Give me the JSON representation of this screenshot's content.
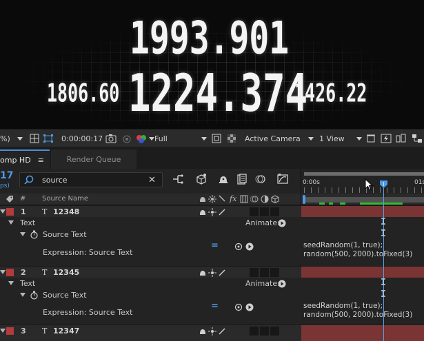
{
  "viewer": {
    "numbers": {
      "top": "1993.901",
      "middle": "1224.374",
      "left": "1806.60",
      "right": "1426.22"
    }
  },
  "viewer_toolbar": {
    "zoom_fragment": "%)",
    "timecode": "0:00:00:17",
    "resolution": "Full",
    "camera": "Active Camera",
    "views": "1 View"
  },
  "tabs": {
    "comp": "omp HD",
    "comp_menu": "≡",
    "render_queue": "Render Queue"
  },
  "timeline": {
    "current_frame": "17",
    "current_frame_sub": "ps)",
    "search_value": "source",
    "ruler_start": "0:00s",
    "ruler_end": "01s"
  },
  "columns": {
    "number": "#",
    "source_name": "Source Name"
  },
  "layers": [
    {
      "number": "1",
      "name": "12348",
      "group": "Text",
      "animate_label": "Animate:",
      "property": "Source Text",
      "expression_label": "Expression: Source Text",
      "expression_line1": "seedRandom(1, true);",
      "expression_line2": "random(500, 2000).toFixed(3)"
    },
    {
      "number": "2",
      "name": "12345",
      "group": "Text",
      "animate_label": "Animate:",
      "property": "Source Text",
      "expression_label": "Expression: Source Text",
      "expression_line1": "seedRandom(1, true);",
      "expression_line2": "random(500, 2000).toFixed(3)"
    },
    {
      "number": "3",
      "name": "12347"
    }
  ],
  "colors": {
    "accent_blue": "#4d9bea",
    "layer_label_red": "#b23b3b",
    "layer_bar_red": "#7a3434",
    "keyframe_green": "#2fbf2f"
  },
  "icons": [
    "search-icon",
    "clear-icon",
    "camera-icon",
    "color-channels-icon",
    "playhead-icon",
    "text-layer-icon",
    "stopwatch-icon",
    "expression-pickwhip-icon",
    "graph-icon",
    "shy-icon",
    "motion-blur-icon",
    "eye-icon",
    "lock-icon",
    "mouse-cursor-icon"
  ]
}
